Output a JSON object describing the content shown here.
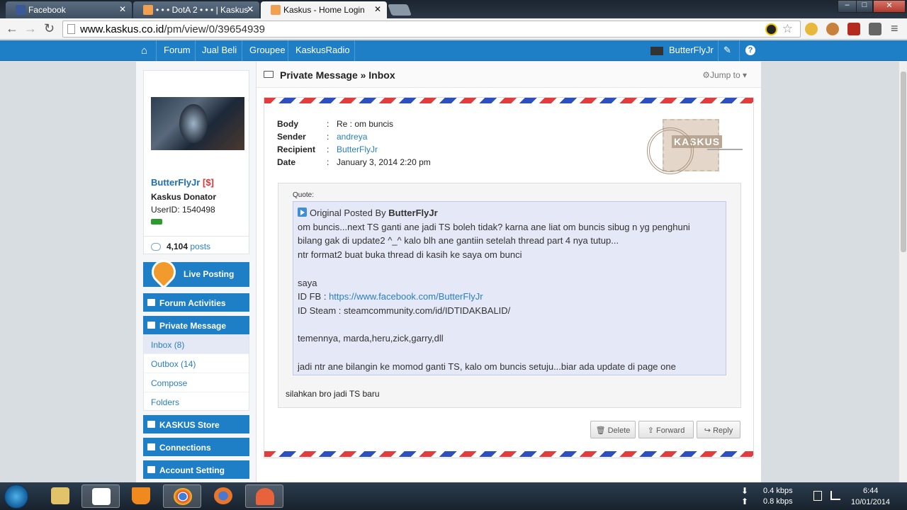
{
  "browser": {
    "tabs": [
      {
        "label": "Facebook",
        "active": false
      },
      {
        "label": "• • • DotA 2 • • • | Kaskus -",
        "active": false
      },
      {
        "label": "Kaskus - Home Login",
        "active": true
      }
    ],
    "url_host": "www.kaskus.co.id",
    "url_path": "/pm/view/0/39654939"
  },
  "nav": {
    "links": [
      "Forum",
      "Jual Beli",
      "Groupee",
      "KaskusRadio"
    ],
    "username": "ButterFlyJr"
  },
  "profile": {
    "name": "ButterFlyJr",
    "donator_tag": "[$]",
    "rank": "Kaskus Donator",
    "userid": "UserID: 1540498",
    "post_count": "4,104",
    "post_label": "posts"
  },
  "sidebar": {
    "live_posting": "Live Posting",
    "forum_activities": "Forum Activities",
    "private_message": "Private Message",
    "pm_items": [
      "Inbox (8)",
      "Outbox (14)",
      "Compose",
      "Folders"
    ],
    "kaskus_store": "KASKUS Store",
    "connections": "Connections",
    "account_setting": "Account Setting"
  },
  "main": {
    "title": "Private Message » Inbox",
    "jump_to": "Jump to"
  },
  "message": {
    "body_label": "Body",
    "body": "Re : om buncis",
    "sender_label": "Sender",
    "sender": "andreya",
    "recipient_label": "Recipient",
    "recipient": "ButterFlyJr",
    "date_label": "Date",
    "date": "January 3, 2014 2:20 pm",
    "separator": ":",
    "stamp_logo": "KASKUS",
    "quote_label": "Quote:",
    "quote_prefix": "Original Posted By",
    "quote_author": "ButterFlyJr",
    "quote_line1": "om buncis...next TS ganti ane jadi TS boleh tidak? karna ane liat om buncis sibug n yg penghuni",
    "quote_line2": "bilang gak di update2 ^_^ kalo blh ane gantiin setelah thread part 4 nya tutup...",
    "quote_line3": "ntr format2 buat buka thread di kasih ke saya om bunci",
    "quote_line4": "saya",
    "quote_fb_prefix": "ID FB :",
    "quote_fb_link": "https://www.facebook.com/ButterFlyJr",
    "quote_line6": "ID Steam : steamcommunity.com/id/IDTIDAKBALID/",
    "quote_line7": "temennya, marda,heru,zick,garry,dll",
    "quote_line8": "jadi ntr ane bilangin ke momod ganti TS, kalo om buncis setuju...biar ada update di page one",
    "reply": "silahkan bro jadi TS baru"
  },
  "actions": {
    "delete": "Delete",
    "forward": "Forward",
    "reply": "Reply"
  },
  "taskbar": {
    "down_speed": "0.4 kbps",
    "up_speed": "0.8 kbps",
    "time": "6:44",
    "date": "10/01/2014"
  },
  "colors": {
    "kaskus_blue": "#1e7fc6",
    "link_blue": "#2a7fc0",
    "donator_red": "#dd3333"
  }
}
